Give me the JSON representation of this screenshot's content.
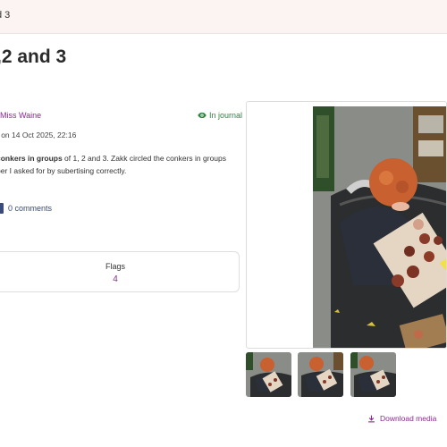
{
  "breadcrumb": "d 3",
  "title": ",2 and 3",
  "author": "Miss Waine",
  "journal_status": "In journal",
  "meta": "r on 14 Oct 2025, 22:16",
  "description": {
    "bold_part": "conkers in groups",
    "line1_rest": " of 1, 2 and 3. Zakk circled the conkers in groups",
    "line2": "ber I asked for by subertising correctly."
  },
  "comments": "0 comments",
  "flags": {
    "label": "Flags",
    "count": "4"
  },
  "download_label": "Download media",
  "icons": {
    "journal": "eye-icon",
    "comments": "comment-icon",
    "download": "download-icon"
  },
  "colors": {
    "accent": "#8a2a8f",
    "journal": "#2e8540",
    "link": "#3a4a7a",
    "topbar": "#fbf4f3"
  }
}
